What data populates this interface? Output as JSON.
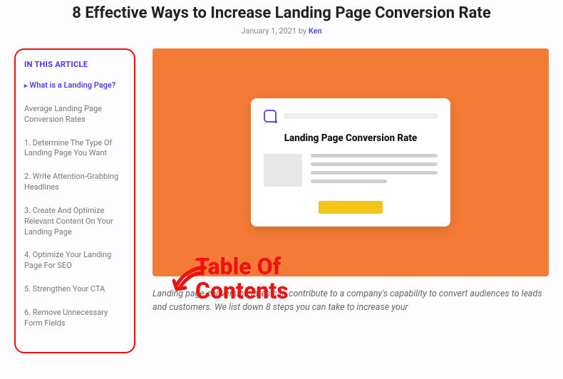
{
  "header": {
    "title": "8 Effective Ways to Increase Landing Page Conversion Rate",
    "date": "January 1, 2021",
    "by_label": "by",
    "author": "Ken"
  },
  "toc": {
    "heading": "IN THIS ARTICLE",
    "items": [
      {
        "label": "What is a Landing Page?",
        "active": true
      },
      {
        "label": "Average Landing Page Conversion Rates",
        "active": false
      },
      {
        "label": "1. Determine The Type Of Landing Page You Want",
        "active": false
      },
      {
        "label": "2. Write Attention-Grabbing Headlines",
        "active": false
      },
      {
        "label": "3. Create And Optimize Relevant Content On Your Landing Page",
        "active": false
      },
      {
        "label": "4. Optimize Your Landing Page For SEO",
        "active": false
      },
      {
        "label": "5. Strengthen Your CTA",
        "active": false
      },
      {
        "label": "6. Remove Unnecessary Form Fields",
        "active": false
      }
    ]
  },
  "hero": {
    "card_heading": "Landing Page Conversion Rate"
  },
  "annotation": {
    "line1": "Table Of",
    "line2": "Contents"
  },
  "intro": "Landing page conversion rates can contribute to a company's capability to convert audiences to leads and customers. We list down 8 steps you can take to increase your",
  "colors": {
    "accent": "#5a3be8",
    "hero_bg": "#f47b35",
    "annotation": "#e11"
  }
}
